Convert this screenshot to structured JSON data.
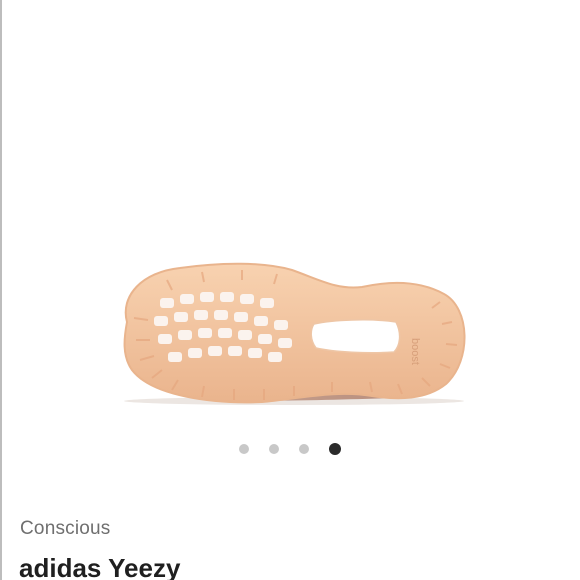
{
  "carousel": {
    "total": 4,
    "active_index": 3
  },
  "product": {
    "tag": "Conscious",
    "title": "adidas Yeezy",
    "sole_text": "boost"
  },
  "colors": {
    "sole": "#f5c8a3",
    "background": "#ffffff",
    "dot_inactive": "#c8c8c8",
    "dot_active": "#2b2b2b"
  }
}
